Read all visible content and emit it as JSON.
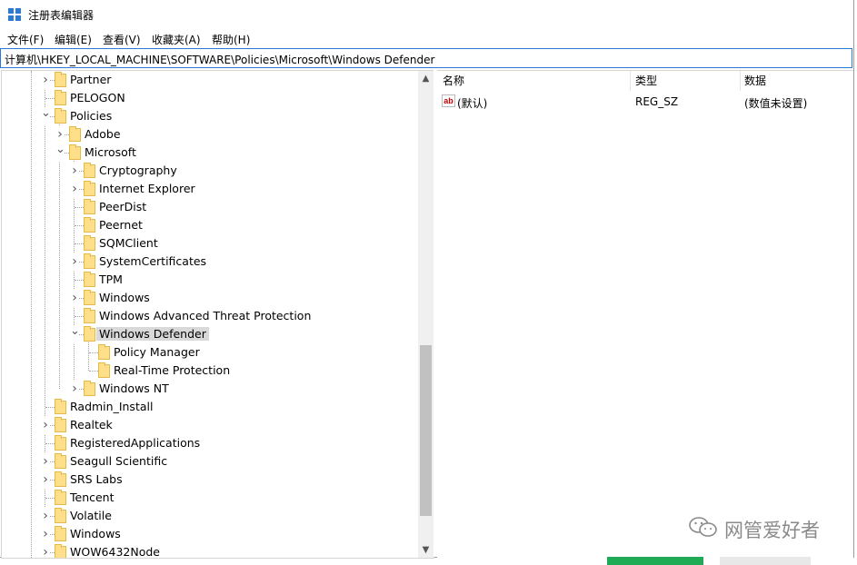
{
  "window": {
    "title": "注册表编辑器"
  },
  "menu": [
    "文件(F)",
    "编辑(E)",
    "查看(V)",
    "收藏夹(A)",
    "帮助(H)"
  ],
  "address": "计算机\\HKEY_LOCAL_MACHINE\\SOFTWARE\\Policies\\Microsoft\\Windows Defender",
  "tree": [
    {
      "label": "Partner",
      "level": 1,
      "expander": "collapsed"
    },
    {
      "label": "PELOGON",
      "level": 1,
      "expander": "none"
    },
    {
      "label": "Policies",
      "level": 1,
      "expander": "expanded"
    },
    {
      "label": "Adobe",
      "level": 2,
      "expander": "collapsed"
    },
    {
      "label": "Microsoft",
      "level": 2,
      "expander": "expanded"
    },
    {
      "label": "Cryptography",
      "level": 3,
      "expander": "collapsed"
    },
    {
      "label": "Internet Explorer",
      "level": 3,
      "expander": "collapsed"
    },
    {
      "label": "PeerDist",
      "level": 3,
      "expander": "none"
    },
    {
      "label": "Peernet",
      "level": 3,
      "expander": "none"
    },
    {
      "label": "SQMClient",
      "level": 3,
      "expander": "none"
    },
    {
      "label": "SystemCertificates",
      "level": 3,
      "expander": "collapsed"
    },
    {
      "label": "TPM",
      "level": 3,
      "expander": "none"
    },
    {
      "label": "Windows",
      "level": 3,
      "expander": "collapsed"
    },
    {
      "label": "Windows Advanced Threat Protection",
      "level": 3,
      "expander": "none"
    },
    {
      "label": "Windows Defender",
      "level": 3,
      "expander": "expanded",
      "selected": true
    },
    {
      "label": "Policy Manager",
      "level": 4,
      "expander": "none"
    },
    {
      "label": "Real-Time Protection",
      "level": 4,
      "expander": "none"
    },
    {
      "label": "Windows NT",
      "level": 3,
      "expander": "collapsed"
    },
    {
      "label": "Radmin_Install",
      "level": 1,
      "expander": "none"
    },
    {
      "label": "Realtek",
      "level": 1,
      "expander": "collapsed"
    },
    {
      "label": "RegisteredApplications",
      "level": 1,
      "expander": "none"
    },
    {
      "label": "Seagull Scientific",
      "level": 1,
      "expander": "collapsed"
    },
    {
      "label": "SRS Labs",
      "level": 1,
      "expander": "collapsed"
    },
    {
      "label": "Tencent",
      "level": 1,
      "expander": "none"
    },
    {
      "label": "Volatile",
      "level": 1,
      "expander": "collapsed"
    },
    {
      "label": "Windows",
      "level": 1,
      "expander": "collapsed"
    },
    {
      "label": "WOW6432Node",
      "level": 1,
      "expander": "collapsed"
    }
  ],
  "list": {
    "columns": [
      "名称",
      "类型",
      "数据"
    ],
    "rows": [
      {
        "icon": "string-value-icon",
        "icon_text": "ab",
        "name": "(默认)",
        "type": "REG_SZ",
        "data": "(数值未设置)"
      }
    ]
  },
  "watermark": {
    "text": "网管爱好者",
    "icon": "wechat-icon"
  },
  "colors": {
    "accent": "#2a7bd8",
    "folder": "#ffe08a",
    "selection": "#d9d9d9"
  }
}
